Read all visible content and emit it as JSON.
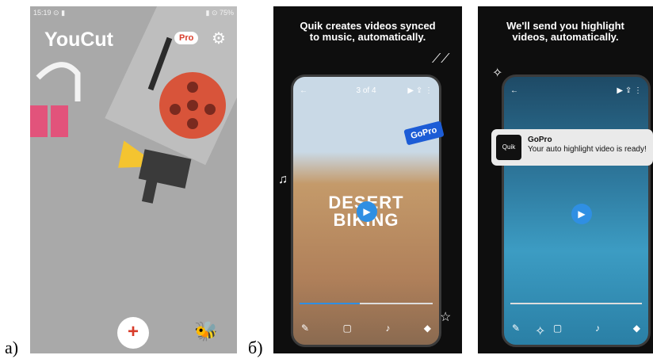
{
  "captions": {
    "a": "а)",
    "b": "б)"
  },
  "youcut": {
    "status_left": "15:19 ⊙ ▮",
    "status_right": "▮ ⊙ 75%",
    "title": "YouCut",
    "pro_badge": "Pro",
    "gear_icon": "gear-icon",
    "add_icon": "+",
    "colors": {
      "background": "#a9a9a9",
      "accent": "#d83c2b"
    }
  },
  "quik1": {
    "headline": "Quik creates videos synced to music, automatically.",
    "counter": "3 of 4",
    "video_title": "DESERT BIKING",
    "badge": "GoPro"
  },
  "quik2": {
    "headline": "We'll send you highlight videos, automatically.",
    "notification": {
      "app_icon": "Quik",
      "app_name": "GoPro",
      "message": "Your auto highlight video is ready!"
    }
  }
}
